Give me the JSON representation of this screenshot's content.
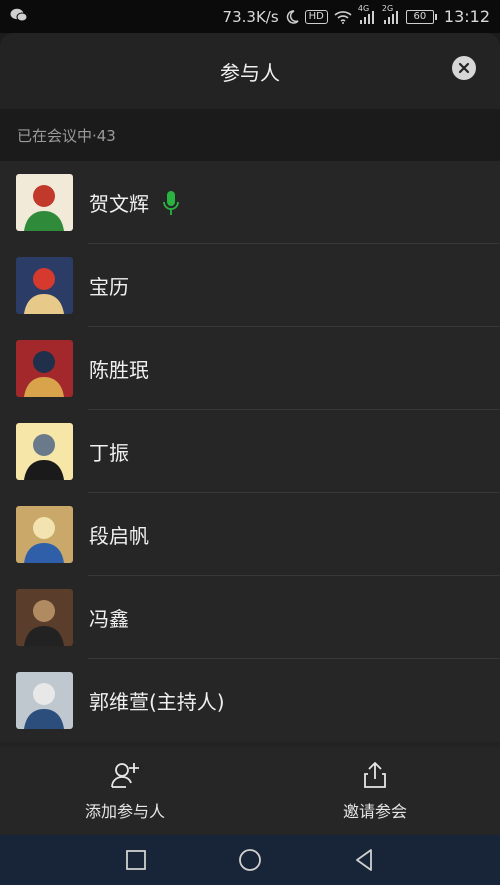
{
  "status_bar": {
    "app_icon": "wechat-icon",
    "speed": "73.3K/s",
    "hd_badge": "HD",
    "network_4g": "4G",
    "network_2g": "2G",
    "battery": "60",
    "time": "13:12"
  },
  "header": {
    "title": "参与人"
  },
  "section": {
    "label": "已在会议中·43"
  },
  "participants": [
    {
      "name": "贺文辉",
      "speaking": true,
      "avatar_colors": [
        "#f1ead9",
        "#2f8b3a",
        "#c0392b"
      ]
    },
    {
      "name": "宝历",
      "speaking": false,
      "avatar_colors": [
        "#2b3d66",
        "#e7c98a",
        "#d63a2f"
      ]
    },
    {
      "name": "陈胜珉",
      "speaking": false,
      "avatar_colors": [
        "#a3282b",
        "#d8a34a",
        "#20304a"
      ]
    },
    {
      "name": "丁振",
      "speaking": false,
      "avatar_colors": [
        "#f6e6a8",
        "#1a1a1a",
        "#6a7a8a"
      ]
    },
    {
      "name": "段启帆",
      "speaking": false,
      "avatar_colors": [
        "#c9a86a",
        "#2f5fa8",
        "#f3e3b0"
      ]
    },
    {
      "name": "冯鑫",
      "speaking": false,
      "avatar_colors": [
        "#5a3d2a",
        "#222222",
        "#b08a60"
      ]
    },
    {
      "name": "郭维萱(主持人)",
      "speaking": false,
      "avatar_colors": [
        "#bfc7cf",
        "#2b4e7c",
        "#e8e8e8"
      ]
    }
  ],
  "footer": {
    "add_label": "添加参与人",
    "invite_label": "邀请参会"
  },
  "colors": {
    "mic_active": "#2bb341",
    "sheet_bg": "#232323",
    "nav_bg": "#182437"
  }
}
